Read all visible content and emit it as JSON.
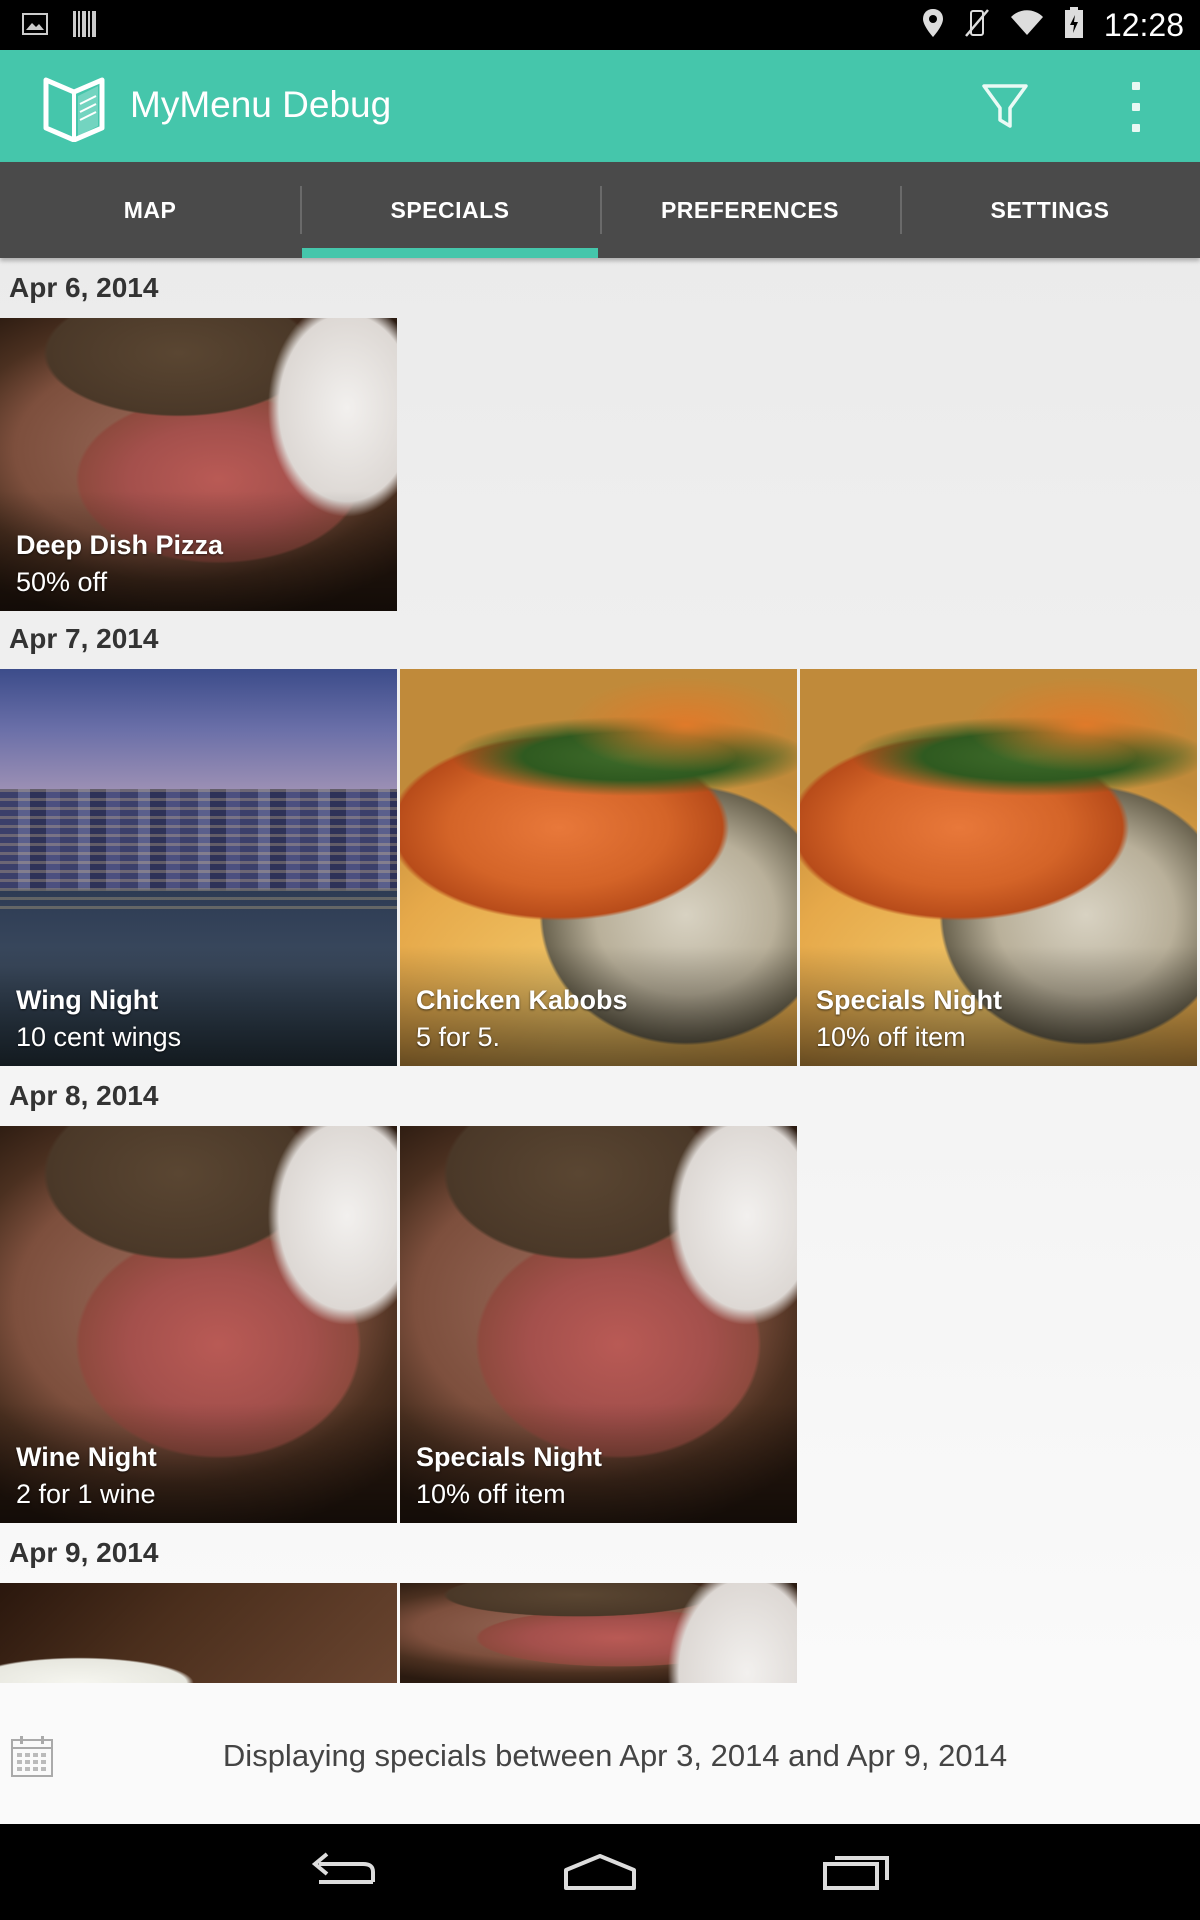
{
  "status_bar": {
    "time": "12:28",
    "left_icons": [
      "picture-notification-icon",
      "barcode-notification-icon"
    ],
    "right_icons": [
      "location-icon",
      "vibrate-off-icon",
      "wifi-icon",
      "battery-icon"
    ]
  },
  "action_bar": {
    "app_title": "MyMenu Debug",
    "accent_color": "#45c6ab",
    "actions": [
      "filter-icon",
      "overflow-menu-icon"
    ]
  },
  "tabs": [
    {
      "label": "MAP",
      "active": false
    },
    {
      "label": "SPECIALS",
      "active": true
    },
    {
      "label": "PREFERENCES",
      "active": false
    },
    {
      "label": "SETTINGS",
      "active": false
    }
  ],
  "sections": [
    {
      "date": "Apr 6, 2014",
      "specials": [
        {
          "title": "Deep Dish Pizza",
          "subtitle": "50% off",
          "image": "roast-beef"
        }
      ]
    },
    {
      "date": "Apr 7, 2014",
      "specials": [
        {
          "title": "Wing Night",
          "subtitle": "10 cent wings",
          "image": "city-skyline"
        },
        {
          "title": "Chicken Kabobs",
          "subtitle": "5 for 5.",
          "image": "salmon-rice"
        },
        {
          "title": "Specials Night",
          "subtitle": "10% off item",
          "image": "salmon-rice"
        }
      ]
    },
    {
      "date": "Apr 8, 2014",
      "specials": [
        {
          "title": "Wine Night",
          "subtitle": "2 for 1 wine",
          "image": "roast-beef"
        },
        {
          "title": "Specials Night",
          "subtitle": "10% off item",
          "image": "roast-beef"
        }
      ]
    },
    {
      "date": "Apr 9, 2014",
      "specials": [
        {
          "title": "",
          "subtitle": "",
          "image": "beer"
        },
        {
          "title": "",
          "subtitle": "",
          "image": "roast-beef"
        }
      ]
    }
  ],
  "footer": {
    "info_text": "Displaying specials between Apr 3, 2014 and Apr 9, 2014",
    "icon": "calendar-icon"
  },
  "nav_bar": [
    "back-icon",
    "home-icon",
    "recents-icon"
  ]
}
